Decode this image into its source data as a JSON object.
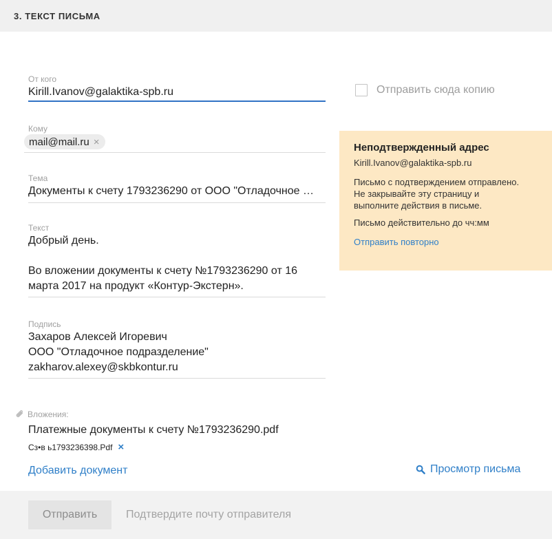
{
  "section": {
    "title": "3. ТЕКСТ ПИСЬМА"
  },
  "form": {
    "from": {
      "label": "От кого",
      "value": "Kirill.Ivanov@galaktika-spb.ru"
    },
    "to": {
      "label": "Кому",
      "recipients": [
        "mail@mail.ru"
      ]
    },
    "subject": {
      "label": "Тема",
      "value": "Документы к счету 1793236290 от ООО \"Отладочное …"
    },
    "body": {
      "label": "Текст",
      "value": "Добрый день.\n\nВо вложении документы к счету №1793236290 от 16\nмарта 2017 на продукт «Контур-Экстерн»."
    },
    "signature": {
      "label": "Подпись",
      "value": "Захаров Алексей Игоревич\nООО \"Отладочное подразделение\"\nzakharov.alexey@skbkontur.ru"
    }
  },
  "copy": {
    "label": "Отправить сюда копию",
    "checked": false
  },
  "notice": {
    "title": "Неподтвержденный адрес",
    "email": "Kirill.Ivanov@galaktika-spb.ru",
    "text": "Письмо с подтверждением отправлено.\nНе закрывайте эту страницу и\nвыполните действия в письме.",
    "validity": "Письмо действительно до чч:мм",
    "resend": "Отправить повторно",
    "background": "#fde8c4"
  },
  "attachments": {
    "label": "Вложения:",
    "files": [
      "Платежные документы к счету №1793236290.pdf",
      "Сз•в ь1793236398.Pdf"
    ],
    "add_label": "Добавить документ",
    "preview_label": "Просмотр письма"
  },
  "footer": {
    "send_label": "Отправить",
    "hint": "Подтвердите почту отправителя"
  },
  "colors": {
    "accent": "#2f7fc8",
    "active_underline": "#3072c4"
  },
  "icons": {
    "remove": "×",
    "attachment": "paperclip-icon",
    "search": "search-icon"
  }
}
